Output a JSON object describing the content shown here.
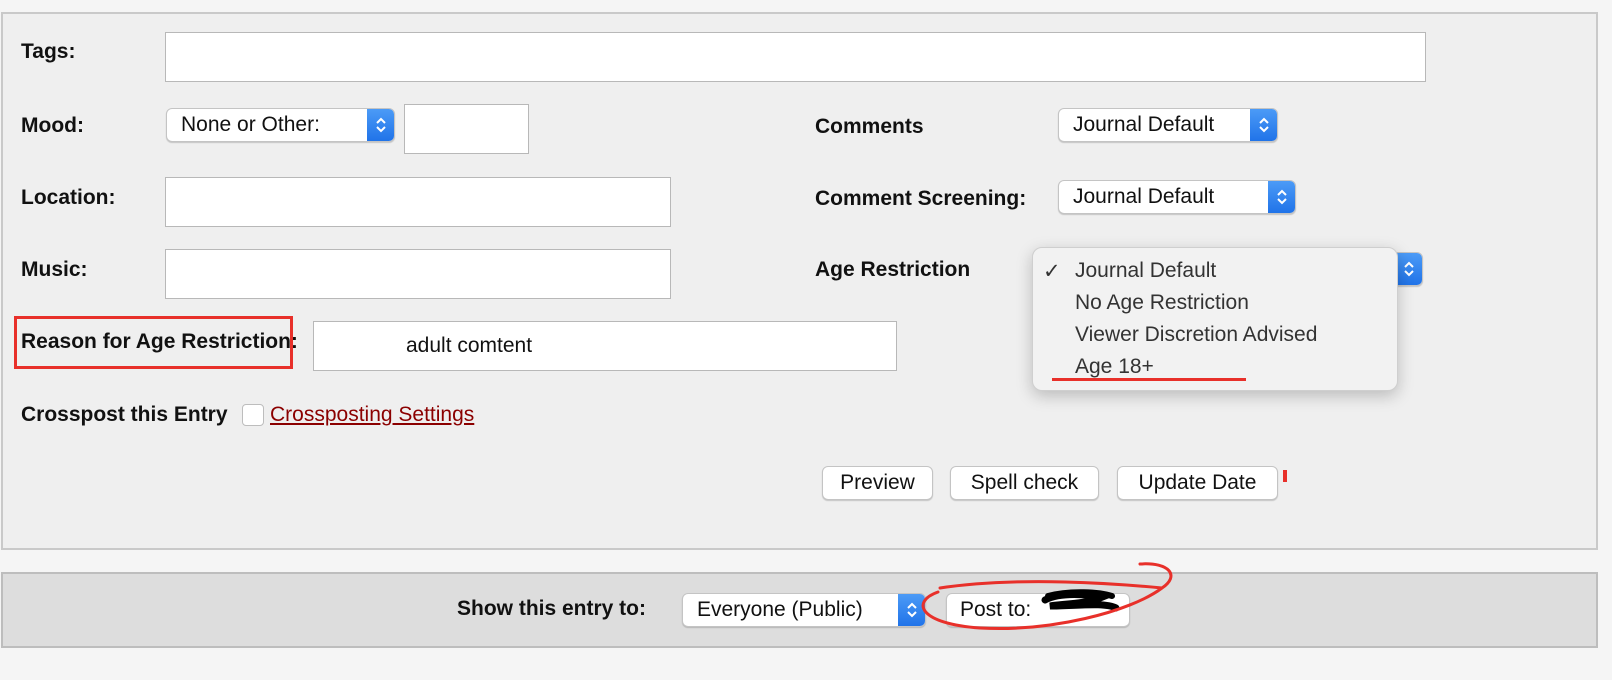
{
  "form": {
    "tags_label": "Tags:",
    "mood_label": "Mood:",
    "mood_select": "None or Other:",
    "location_label": "Location:",
    "music_label": "Music:",
    "reason_label": "Reason for Age Restriction:",
    "reason_value": "adult comtent",
    "crosspost_label": "Crosspost this Entry",
    "crosspost_link": "Crossposting Settings",
    "comments_label": "Comments",
    "comments_select": "Journal Default",
    "screening_label": "Comment Screening:",
    "screening_select": "Journal Default",
    "age_label": "Age Restriction"
  },
  "age_menu": {
    "items": [
      {
        "label": "Journal Default",
        "checked": true
      },
      {
        "label": "No Age Restriction",
        "checked": false
      },
      {
        "label": "Viewer Discretion Advised",
        "checked": false
      },
      {
        "label": "Age 18+",
        "checked": false
      }
    ],
    "check_glyph": "✓"
  },
  "buttons": {
    "preview": "Preview",
    "spell_check": "Spell check",
    "update_date": "Update Date"
  },
  "footer": {
    "show_label": "Show this entry to:",
    "visibility_select": "Everyone (Public)",
    "post_to": "Post to:"
  },
  "colors": {
    "annotation": "#e8302a",
    "link": "#8b0000",
    "stepper": "#2f80ed"
  }
}
